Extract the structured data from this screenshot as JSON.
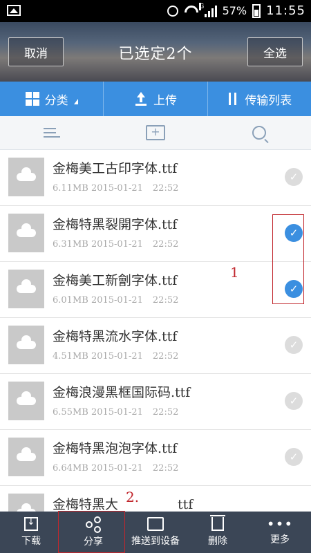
{
  "status_bar": {
    "battery": "57%",
    "time": "11:55",
    "network": "G"
  },
  "header": {
    "cancel_label": "取消",
    "title": "已选定2个",
    "select_all_label": "全选"
  },
  "toolbar": {
    "category_label": "分类",
    "upload_label": "上传",
    "transfer_list_label": "传输列表"
  },
  "files": [
    {
      "name": "金梅美工古印字体.ttf",
      "size": "6.11MB",
      "date": "2015-01-21",
      "time": "22:52",
      "checked": false
    },
    {
      "name": "金梅特黑裂開字体.ttf",
      "size": "6.31MB",
      "date": "2015-01-21",
      "time": "22:52",
      "checked": true
    },
    {
      "name": "金梅美工新劊字体.ttf",
      "size": "6.01MB",
      "date": "2015-01-21",
      "time": "22:52",
      "checked": true
    },
    {
      "name": "金梅特黑流水字体.ttf",
      "size": "4.51MB",
      "date": "2015-01-21",
      "time": "22:52",
      "checked": false
    },
    {
      "name": "金梅浪漫黑框国际码.ttf",
      "size": "6.55MB",
      "date": "2015-01-21",
      "time": "22:52",
      "checked": false
    },
    {
      "name": "金梅特黑泡泡字体.ttf",
      "size": "6.64MB",
      "date": "2015-01-21",
      "time": "22:52",
      "checked": false
    },
    {
      "name": "金梅特黑大",
      "size": "",
      "date": "",
      "time": "",
      "checked": false,
      "name_suffix": "ttf"
    }
  ],
  "annotations": {
    "label_1": "1",
    "label_2": "2."
  },
  "bottom_bar": {
    "download_label": "下载",
    "share_label": "分享",
    "push_label": "推送到设备",
    "delete_label": "删除",
    "more_label": "更多"
  },
  "colors": {
    "accent": "#3b8fe0",
    "bottom_bar": "#3b4656",
    "annotation": "#c1272d"
  }
}
